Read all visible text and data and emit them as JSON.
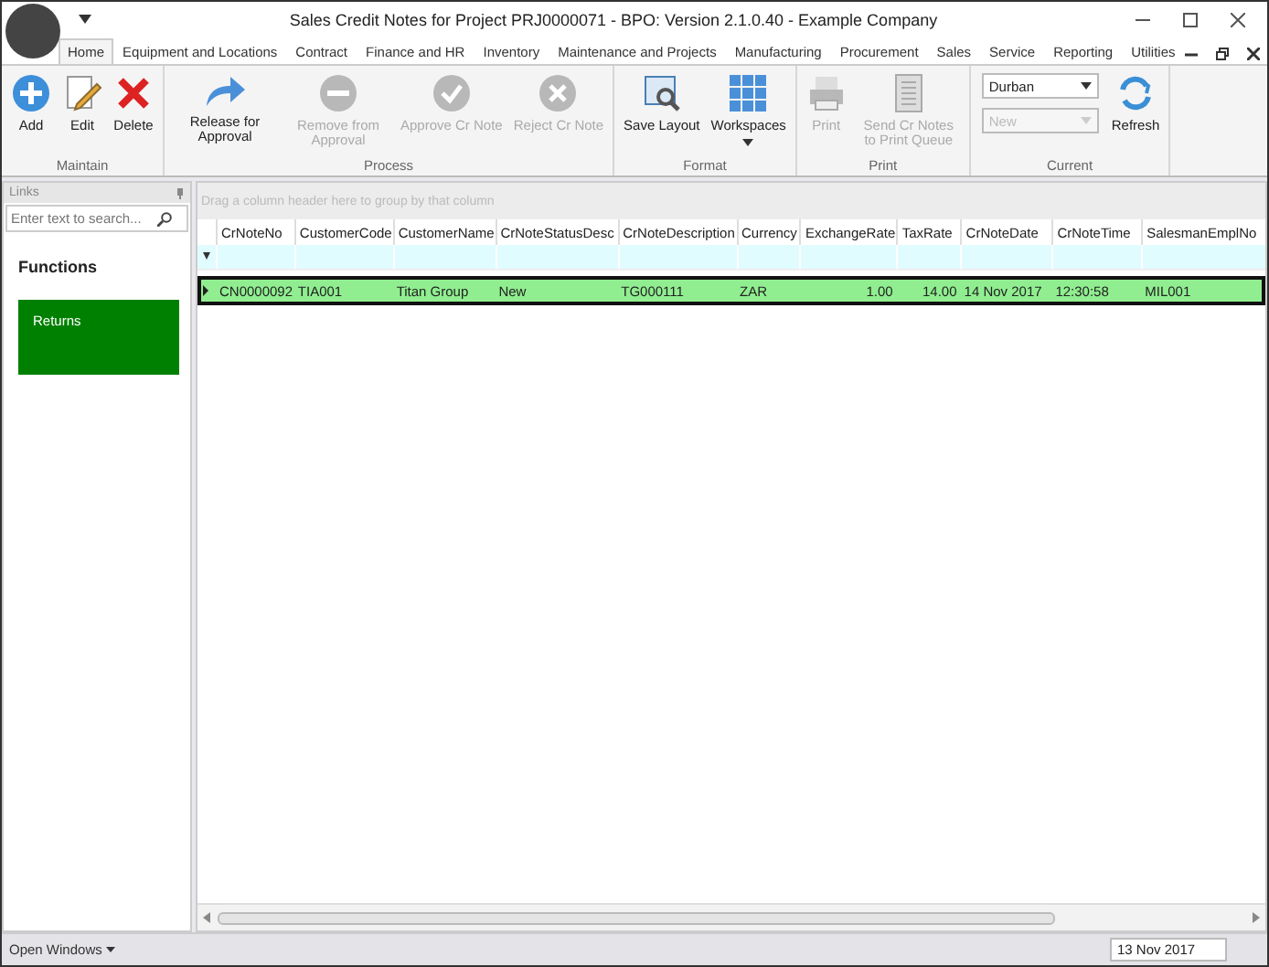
{
  "window": {
    "title": "Sales Credit Notes for Project PRJ0000071 - BPO: Version 2.1.0.40 - Example Company"
  },
  "menu_tabs": [
    {
      "label": "Home",
      "selected": true
    },
    {
      "label": "Equipment and Locations",
      "selected": false
    },
    {
      "label": "Contract",
      "selected": false
    },
    {
      "label": "Finance and HR",
      "selected": false
    },
    {
      "label": "Inventory",
      "selected": false
    },
    {
      "label": "Maintenance and Projects",
      "selected": false
    },
    {
      "label": "Manufacturing",
      "selected": false
    },
    {
      "label": "Procurement",
      "selected": false
    },
    {
      "label": "Sales",
      "selected": false
    },
    {
      "label": "Service",
      "selected": false
    },
    {
      "label": "Reporting",
      "selected": false
    },
    {
      "label": "Utilities",
      "selected": false
    }
  ],
  "ribbon_groups": [
    {
      "title": "Maintain",
      "items": [
        {
          "kind": "button",
          "label": "Add",
          "disabled": false
        },
        {
          "kind": "button",
          "label": "Edit",
          "disabled": false
        },
        {
          "kind": "button",
          "label": "Delete",
          "disabled": false
        }
      ]
    },
    {
      "title": "Process",
      "items": [
        {
          "kind": "button",
          "label": "Release for Approval",
          "disabled": false
        },
        {
          "kind": "button",
          "label": "Remove from Approval",
          "disabled": true
        },
        {
          "kind": "button",
          "label": "Approve Cr Note",
          "disabled": true
        },
        {
          "kind": "button",
          "label": "Reject Cr Note",
          "disabled": true
        }
      ]
    },
    {
      "title": "Format",
      "items": [
        {
          "kind": "button",
          "label": "Save Layout",
          "disabled": false
        },
        {
          "kind": "menu",
          "label": "Workspaces",
          "disabled": false
        }
      ]
    },
    {
      "title": "Print",
      "items": [
        {
          "kind": "button",
          "label": "Print",
          "disabled": true
        },
        {
          "kind": "button",
          "label": "Send Cr Notes to Print Queue",
          "disabled": true
        }
      ]
    },
    {
      "title": "Current",
      "items": [
        {
          "kind": "dropdowns",
          "fields": [
            {
              "value": "Durban",
              "disabled": false
            },
            {
              "value": "New",
              "disabled": true
            }
          ]
        },
        {
          "kind": "button",
          "label": "Refresh",
          "disabled": false
        }
      ]
    }
  ],
  "links_panel": {
    "title": "Links",
    "search": {
      "placeholder": "Enter text to search..."
    },
    "heading": "Functions",
    "tiles": [
      {
        "label": "Returns",
        "color": "#008000"
      }
    ]
  },
  "grid": {
    "group_hint": "Drag a column header here to group by that column",
    "columns": [
      "CrNoteNo",
      "CustomerCode",
      "CustomerName",
      "CrNoteStatusDesc",
      "CrNoteDescription",
      "Currency",
      "ExchangeRate",
      "TaxRate",
      "CrNoteDate",
      "CrNoteTime",
      "SalesmanEmplNo"
    ],
    "rows": [
      {
        "selected": true,
        "cells": [
          "CN0000092",
          "TIA001",
          "Titan Group",
          "New",
          "TG000111",
          "ZAR",
          "1.00",
          "14.00",
          "14 Nov 2017",
          "12:30:58",
          "MIL001"
        ]
      }
    ]
  },
  "status_bar": {
    "open_windows": "Open Windows",
    "date": "13 Nov 2017"
  }
}
